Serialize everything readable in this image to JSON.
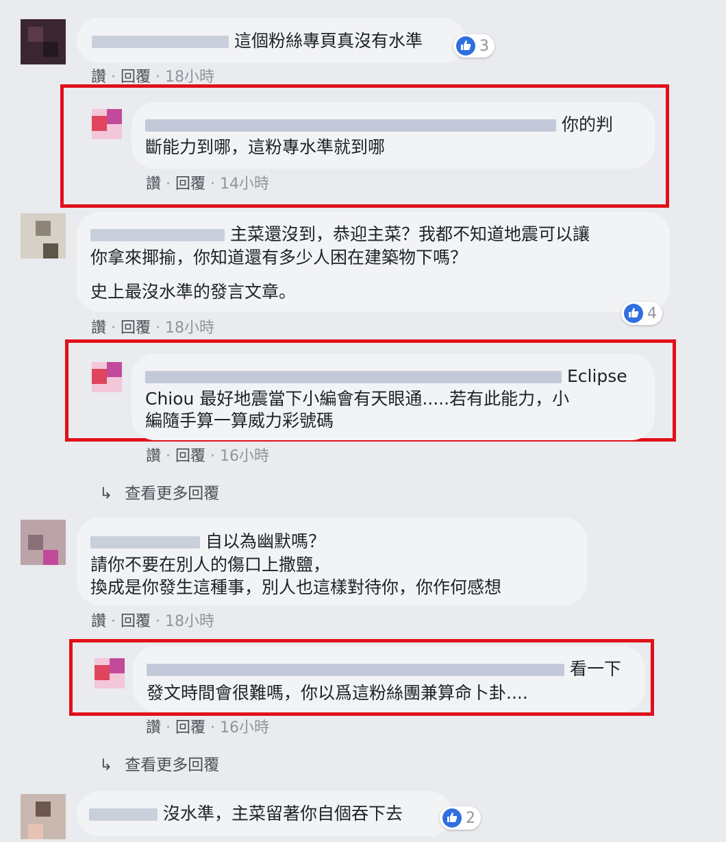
{
  "comments": [
    {
      "text_lines": [
        "這個粉絲專頁真沒有水準"
      ],
      "like_count": "3",
      "meta": {
        "like": "讚",
        "reply": "回覆",
        "time": "18小時"
      }
    },
    {
      "text_lines": [
        "你的判",
        "斷能力到哪，這粉專水準就到哪"
      ],
      "meta": {
        "like": "讚",
        "reply": "回覆",
        "time": "14小時"
      }
    },
    {
      "text_lines": [
        "主菜還沒到，恭迎主菜？我都不知道地震可以讓",
        "你拿來揶揄，你知道還有多少人困在建築物下嗎？",
        "史上最沒水準的發言文章。"
      ],
      "like_count": "4",
      "meta": {
        "like": "讚",
        "reply": "回覆",
        "time": "18小時"
      }
    },
    {
      "text_lines": [
        "Eclipse",
        "Chiou 最好地震當下小編會有天眼通.....若有此能力，小",
        "編隨手算一算威力彩號碼"
      ],
      "meta": {
        "like": "讚",
        "reply": "回覆",
        "time": "16小時"
      }
    },
    {
      "text_lines": [
        "自以為幽默嗎？",
        "請你不要在別人的傷口上撒鹽，",
        "換成是你發生這種事，別人也這樣對待你，你作何感想"
      ],
      "meta": {
        "like": "讚",
        "reply": "回覆",
        "time": "18小時"
      }
    },
    {
      "text_lines": [
        "看一下",
        "發文時間會很難嗎，你以爲這粉絲團兼算命卜卦...."
      ],
      "meta": {
        "like": "讚",
        "reply": "回覆",
        "time": "16小時"
      }
    },
    {
      "text_lines": [
        "沒水準，主菜留著你自個吞下去"
      ],
      "like_count": "2"
    }
  ],
  "view_more": [
    "查看更多回覆",
    "查看更多回覆"
  ],
  "colors": {
    "highlight": "#e0101a",
    "like": "#2f6fe0",
    "bubble": "#f2f3f5"
  }
}
